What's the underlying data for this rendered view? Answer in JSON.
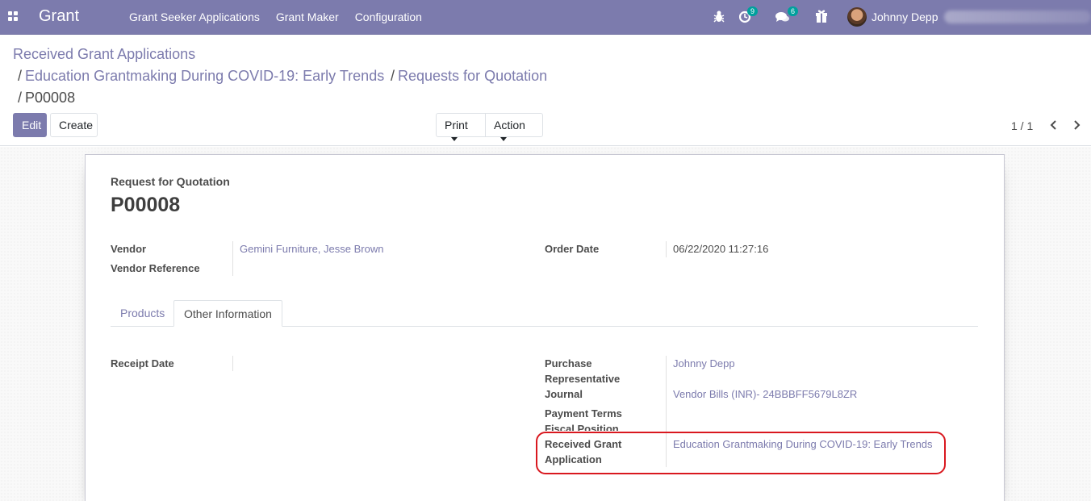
{
  "navbar": {
    "app_name": "Grant",
    "menu": [
      "Grant Seeker Applications",
      "Grant Maker",
      "Configuration"
    ],
    "activity_count": "9",
    "messages_count": "6",
    "username": "Johnny Depp",
    "icons": [
      "apps-icon",
      "bug-icon",
      "activity-clock-icon",
      "chat-icon",
      "gift-icon"
    ]
  },
  "breadcrumb": {
    "items": [
      "Received Grant Applications",
      "Education Grantmaking During COVID-19: Early Trends",
      "Requests for Quotation",
      "P00008"
    ],
    "separator": "/"
  },
  "buttons": {
    "edit": "Edit",
    "create": "Create",
    "print": "Print",
    "action": "Action"
  },
  "pager": {
    "value": "1 / 1"
  },
  "form": {
    "doc_type": "Request for Quotation",
    "name": "P00008",
    "vendor_label": "Vendor",
    "vendor_value": "Gemini Furniture, Jesse Brown",
    "vendor_ref_label": "Vendor Reference",
    "order_date_label": "Order Date",
    "order_date_value": "06/22/2020 11:27:16",
    "tabs": [
      "Products",
      "Other Information"
    ],
    "receipt_date_label": "Receipt Date",
    "purchase_rep_label_1": "Purchase",
    "purchase_rep_label_2": "Representative",
    "purchase_rep_value": "Johnny Depp",
    "journal_label": "Journal",
    "journal_value": "Vendor Bills (INR)- 24BBBFF5679L8ZR",
    "payment_terms_label": "Payment Terms",
    "fiscal_position_label": "Fiscal Position",
    "grant_app_label_1": "Received Grant",
    "grant_app_label_2": "Application",
    "grant_app_value": "Education Grantmaking During COVID-19: Early Trends"
  },
  "colors": {
    "brand": "#7c7bad",
    "badge": "#00a09d",
    "highlight": "#d9181f"
  }
}
